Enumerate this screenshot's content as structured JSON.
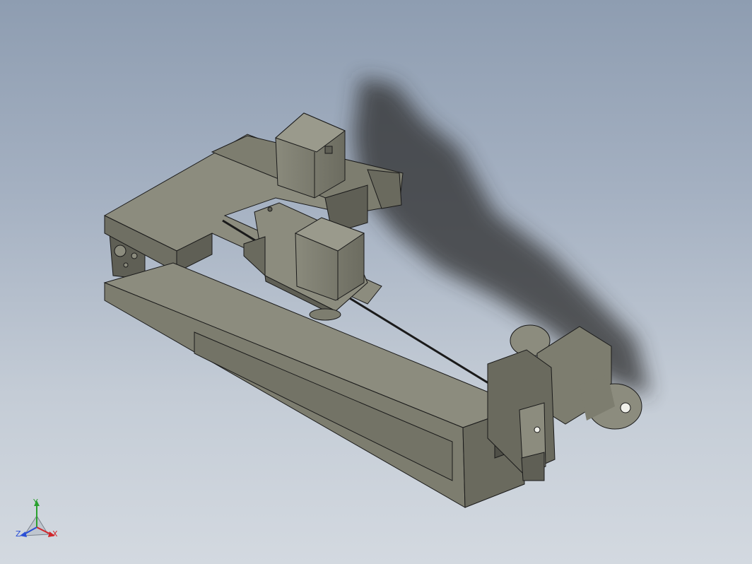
{
  "viewport": {
    "background_top": "#8e9db1",
    "background_bottom": "#d3d9e0"
  },
  "model": {
    "body_color": "#7d7d6f",
    "body_light": "#8c8c7e",
    "body_dark": "#5f5f55",
    "edge_color": "#1a1a1a",
    "shadow_color": "#2e2e2e"
  },
  "triad": {
    "x_label": "X",
    "y_label": "Y",
    "z_label": "Z",
    "x_color": "#d0262b",
    "y_color": "#2aa12f",
    "z_color": "#2a4fd6"
  }
}
